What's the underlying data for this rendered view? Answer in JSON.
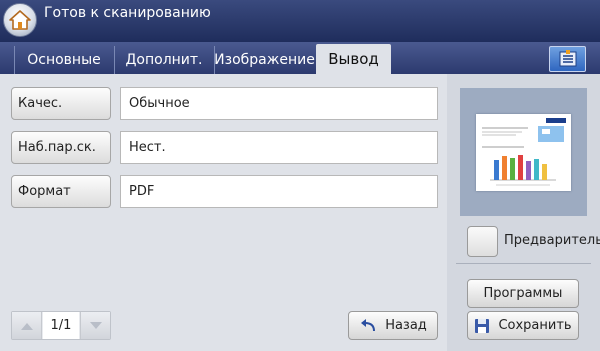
{
  "header": {
    "status": "Готов к сканированию"
  },
  "tabs": [
    "Основные",
    "Дополнит.",
    "Изображение",
    "Вывод"
  ],
  "options": [
    {
      "label": "Качес.",
      "value": "Обычное"
    },
    {
      "label": "Наб.пар.ск.",
      "value": "Нест."
    },
    {
      "label": "Формат",
      "value": "PDF"
    }
  ],
  "pager": {
    "page": "1/1"
  },
  "buttons": {
    "back": "Назад",
    "programs": "Программы",
    "save": "Сохранить"
  },
  "preview": {
    "label": "Предварительный просмотр"
  },
  "icons": {
    "home": "home-icon",
    "menu": "menu-list-icon",
    "up": "arrow-up-icon",
    "down": "arrow-down-icon",
    "back": "undo-arrow-icon",
    "save": "floppy-disk-icon"
  },
  "colors": {
    "header": "#2a3868",
    "tab_bar": "#3a4a80",
    "accent_button": "#2f66c0",
    "preview_frame": "#9dabc1"
  }
}
